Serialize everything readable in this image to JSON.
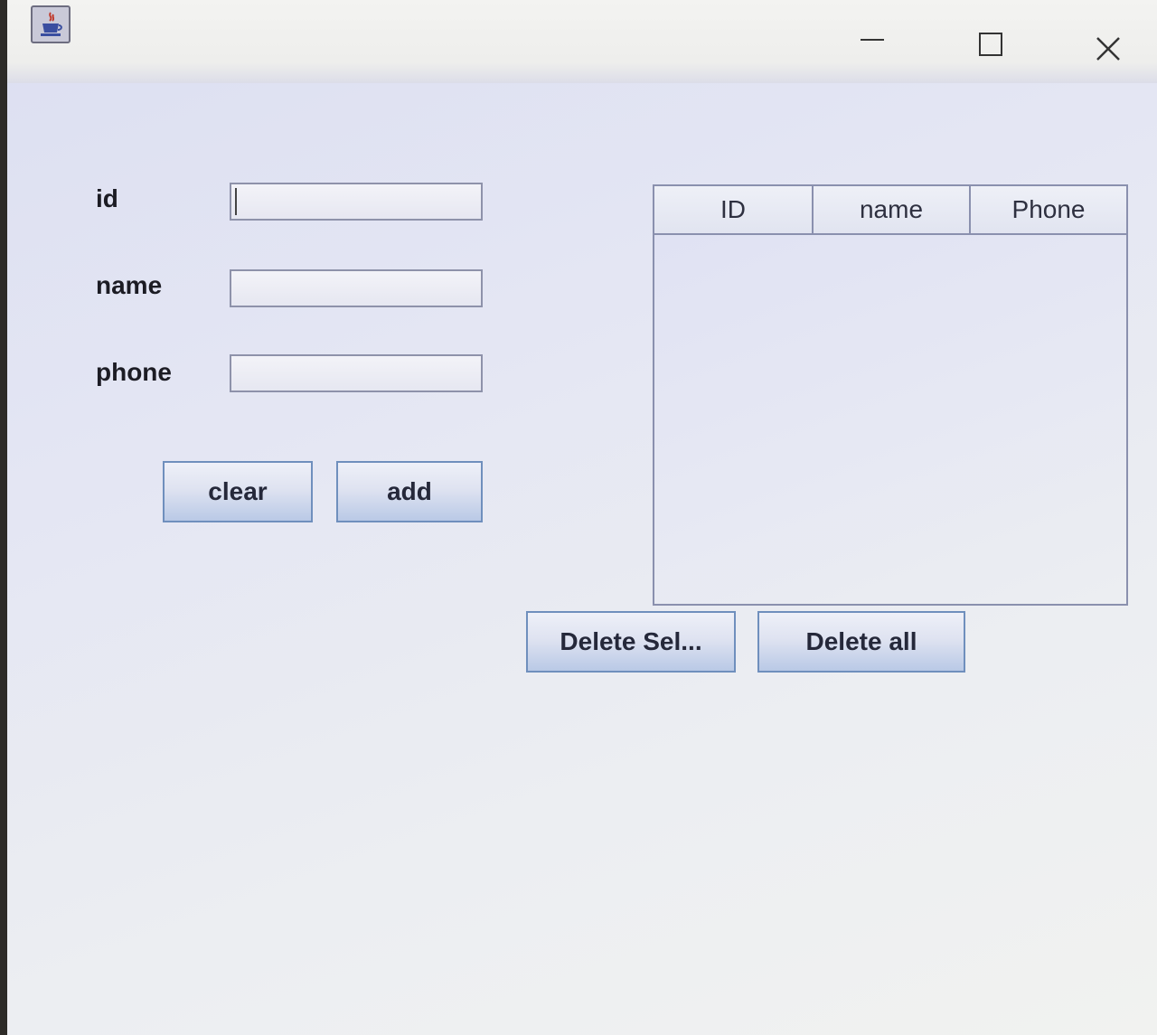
{
  "form": {
    "id_label": "id",
    "id_value": "",
    "name_label": "name",
    "name_value": "",
    "phone_label": "phone",
    "phone_value": "",
    "clear_label": "clear",
    "add_label": "add"
  },
  "table": {
    "columns": [
      "ID",
      "name",
      "Phone"
    ],
    "rows": []
  },
  "actions": {
    "delete_selected_label": "Delete Sel...",
    "delete_all_label": "Delete all"
  },
  "colors": {
    "window_bg": "#e4e6f3",
    "button_border": "#6f8fbd"
  },
  "icons": {
    "app": "java-coffee-cup-icon",
    "minimize": "minimize-icon",
    "maximize": "maximize-icon",
    "close": "close-icon"
  }
}
